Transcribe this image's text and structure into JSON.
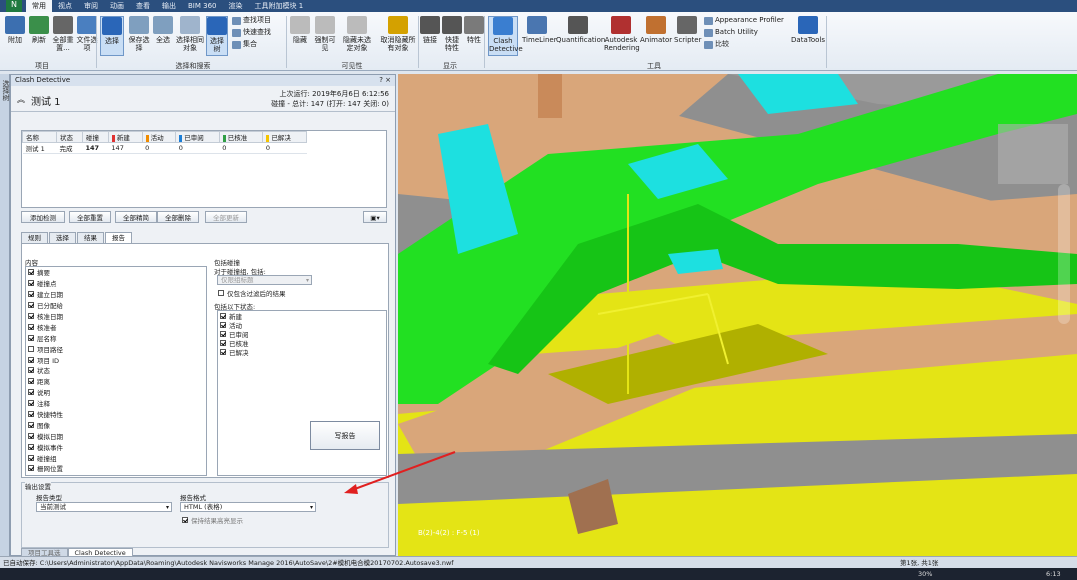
{
  "ribbon_tabs": [
    "常用",
    "视点",
    "审阅",
    "动画",
    "查看",
    "输出",
    "BIM 360",
    "渲染",
    "工具附加模块 1"
  ],
  "ribbon": {
    "buttons": [
      "附加",
      "刷新",
      "全部重置...",
      "文件选项",
      "选择",
      "保存选择",
      "全选",
      "选择相同对象",
      "选择树",
      "隐藏",
      "强制可见",
      "隐藏未选定对象",
      "取消隐藏所有对象",
      "链接",
      "快捷特性",
      "特性",
      "Clash Detective",
      "TimeLiner",
      "Quantification",
      "Autodesk Rendering",
      "Animator",
      "Scripter",
      "DataTools"
    ],
    "small_items": [
      "查找项目",
      "快速查找",
      "集合",
      "Appearance Profiler",
      "Batch Utility",
      "比较"
    ],
    "groups": [
      "项目",
      "选择和搜索",
      "可见性",
      "显示",
      "工具"
    ]
  },
  "sidestrip": "选择树",
  "panel": {
    "title": "Clash Detective",
    "test_name": "测试 1",
    "last_run": "上次运行: 2019年6月6日 6:12:56",
    "summary": "碰撞 - 总计: 147  (打开: 147  关闭: 0)",
    "grid": {
      "headers": [
        "名称",
        "状态",
        "碰撞",
        "新建",
        "活动",
        "已审阅",
        "已核准",
        "已解决"
      ],
      "header_colors": [
        "",
        "",
        "",
        "#e03131",
        "#f08c00",
        "#1c7ed6",
        "#2f9e44",
        "#f5c400"
      ],
      "rows": [
        [
          "测试 1",
          "完成",
          "147",
          "147",
          "0",
          "0",
          "0",
          "0"
        ]
      ]
    },
    "buttons": [
      "添加检测",
      "全部重置",
      "全部精简",
      "全部删除",
      "全部更新"
    ],
    "subtabs": [
      "规则",
      "选择",
      "结果",
      "报告"
    ],
    "content_label": "内容",
    "content_items": [
      {
        "label": "摘要",
        "checked": true
      },
      {
        "label": "碰撞点",
        "checked": true
      },
      {
        "label": "建立日期",
        "checked": true
      },
      {
        "label": "已分配给",
        "checked": true
      },
      {
        "label": "核准日期",
        "checked": true
      },
      {
        "label": "核准者",
        "checked": true
      },
      {
        "label": "层名称",
        "checked": true
      },
      {
        "label": "项目路径",
        "checked": false
      },
      {
        "label": "项目 ID",
        "checked": true
      },
      {
        "label": "状态",
        "checked": true
      },
      {
        "label": "距离",
        "checked": true
      },
      {
        "label": "说明",
        "checked": true
      },
      {
        "label": "注释",
        "checked": true
      },
      {
        "label": "快捷特性",
        "checked": true
      },
      {
        "label": "图像",
        "checked": true
      },
      {
        "label": "模拟日期",
        "checked": true
      },
      {
        "label": "模拟事件",
        "checked": true
      },
      {
        "label": "碰撞组",
        "checked": true
      },
      {
        "label": "栅网位置",
        "checked": true
      }
    ],
    "include_label": "包括碰撞",
    "group_label": "对于碰撞组, 包括:",
    "group_value": "仅限组标题",
    "filter_label": "仅包含过滤后的结果",
    "status_label": "包括以下状态:",
    "status_items": [
      "新建",
      "活动",
      "已审阅",
      "已核准",
      "已解决"
    ],
    "output_label": "输出设置",
    "report_type_label": "报告类型",
    "report_type": "当前测试",
    "report_format_label": "报告格式",
    "report_format": "HTML (表格)",
    "keep_label": "保持结果高亮显示",
    "write_button": "写报告",
    "bottom_tabs": [
      "项目工具选",
      "Clash Detective"
    ]
  },
  "viewport_label": "B(2)-4(2) : F-5 (1)",
  "status_bar": {
    "path": "已自动保存: C:\\Users\\Administrator\\AppData\\Roaming\\Autodesk Navisworks Manage 2016\\AutoSave\\2#模机电合模20170702.Autosave3.nwf",
    "page": "第1张, 共1张"
  },
  "taskbar": {
    "time": "6:13",
    "zoom": "30%"
  }
}
